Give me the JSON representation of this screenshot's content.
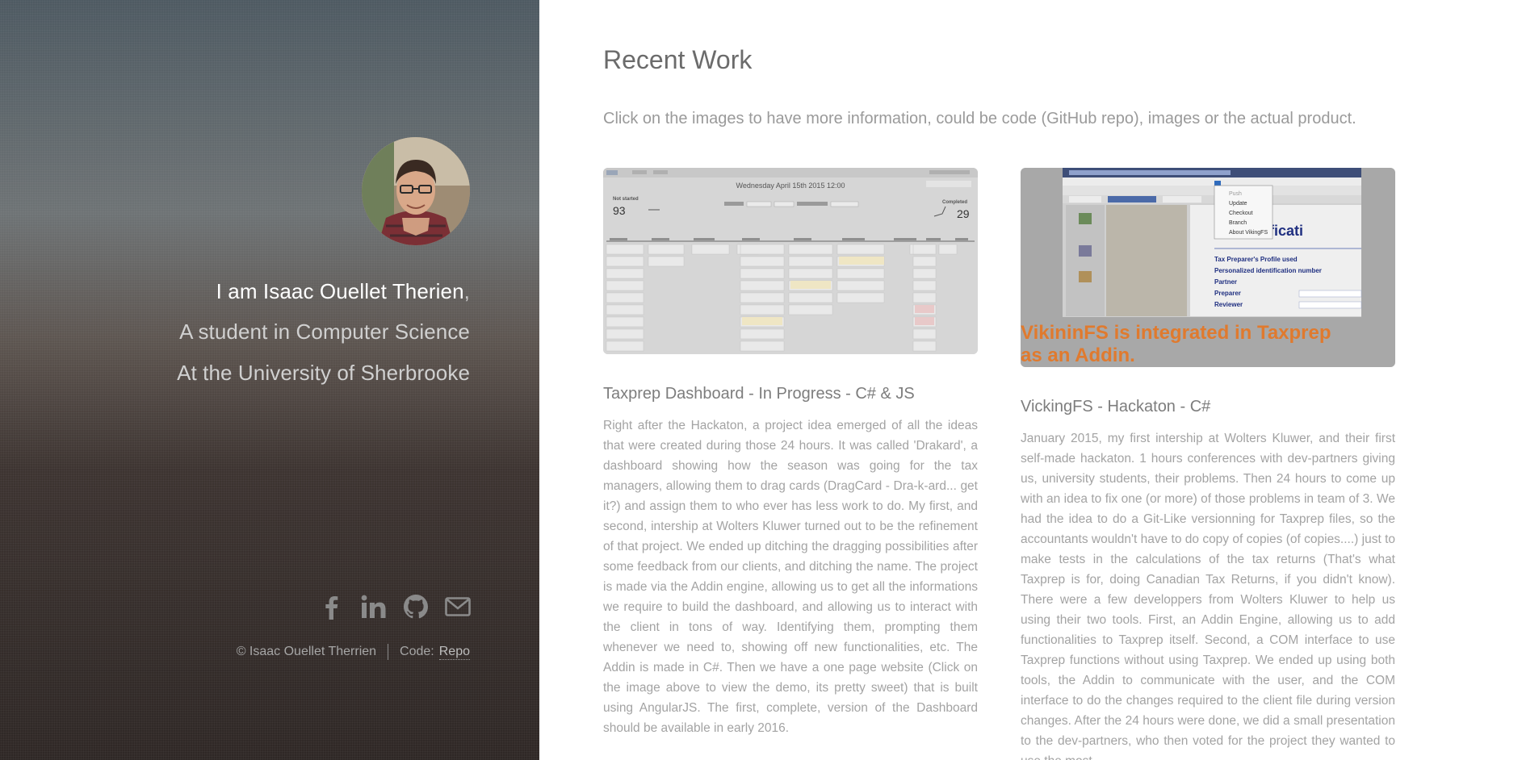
{
  "sidebar": {
    "avatar_alt": "Isaac Ouellet Therien",
    "intro_name": "I am Isaac Ouellet Therien",
    "intro_comma": ",",
    "intro_line2": "A student in Computer Science",
    "intro_line3": "At the University of Sherbrooke",
    "social": [
      {
        "name": "facebook-icon"
      },
      {
        "name": "linkedin-icon"
      },
      {
        "name": "github-icon"
      },
      {
        "name": "mail-icon"
      }
    ],
    "copyright": "© Isaac Ouellet Therrien",
    "code_label": "Code:",
    "repo_link": "Repo"
  },
  "main": {
    "title": "Recent Work",
    "subtitle": "Click on the images to have more information, could be code (GitHub repo), images or the actual product.",
    "projects": [
      {
        "title": "Taxprep Dashboard - In Progress - C# & JS",
        "thumb": {
          "date": "Wednesday April 15th 2015 12:00",
          "not_started_label": "Not started",
          "not_started_value": "93",
          "completed_label": "Completed",
          "completed_value": "29"
        },
        "description": "Right after the Hackaton, a project idea emerged of all the ideas that were created during those 24 hours. It was called 'Drakard', a dashboard showing how the season was going for the tax managers, allowing them to drag cards (DragCard - Dra-k-ard... get it?) and assign them to who ever has less work to do. My first, and second, intership at Wolters Kluwer turned out to be the refinement of that project. We ended up ditching the dragging possibilities after some feedback from our clients, and ditching the name. The project is made via the Addin engine, allowing us to get all the informations we require to build the dashboard, and allowing us to interact with the client in tons of way. Identifying them, prompting them whenever we need to, showing off new functionalities, etc. The Addin is made in C#. Then we have a one page website (Click on the image above to view the demo, its pretty sweet) that is built using AngularJS. The first, complete, version of the Dashboard should be available in early 2016."
      },
      {
        "title": "VickingFS - Hackaton - C#",
        "thumb": {
          "menu_items": [
            "Push",
            "Update",
            "Checkout",
            "Branch",
            "About VikingFS"
          ],
          "overlay_line1": "VikininFS is integrated in Taxprep",
          "overlay_line2": "as an Addin."
        },
        "description": "January 2015, my first intership at Wolters Kluwer, and their first self-made hackaton. 1 hours conferences with dev-partners giving us, university students, their problems. Then 24 hours to come up with an idea to fix one (or more) of those problems in team of 3. We had the idea to do a Git-Like versionning for Taxprep files, so the accountants wouldn't have to do copy of copies (of copies....) just to make tests in the calculations of the tax returns (That's what Taxprep is for, doing Canadian Tax Returns, if you didn't know). There were a few developpers from Wolters Kluwer to help us using their two tools. First, an Addin Engine, allowing us to add functionalities to Taxprep itself. Second, a COM interface to use Taxprep functions without using Taxprep. We ended up using both tools, the Addin to communicate with the user, and the COM interface to do the changes required to the client file during version changes. After the 24 hours were done, we did a small presentation to the dev-partners, who then voted for the project they wanted to use the most."
      }
    ]
  },
  "colors": {
    "overlay_text": "#e07a2e",
    "menu_highlight": "#2f6bbd"
  }
}
